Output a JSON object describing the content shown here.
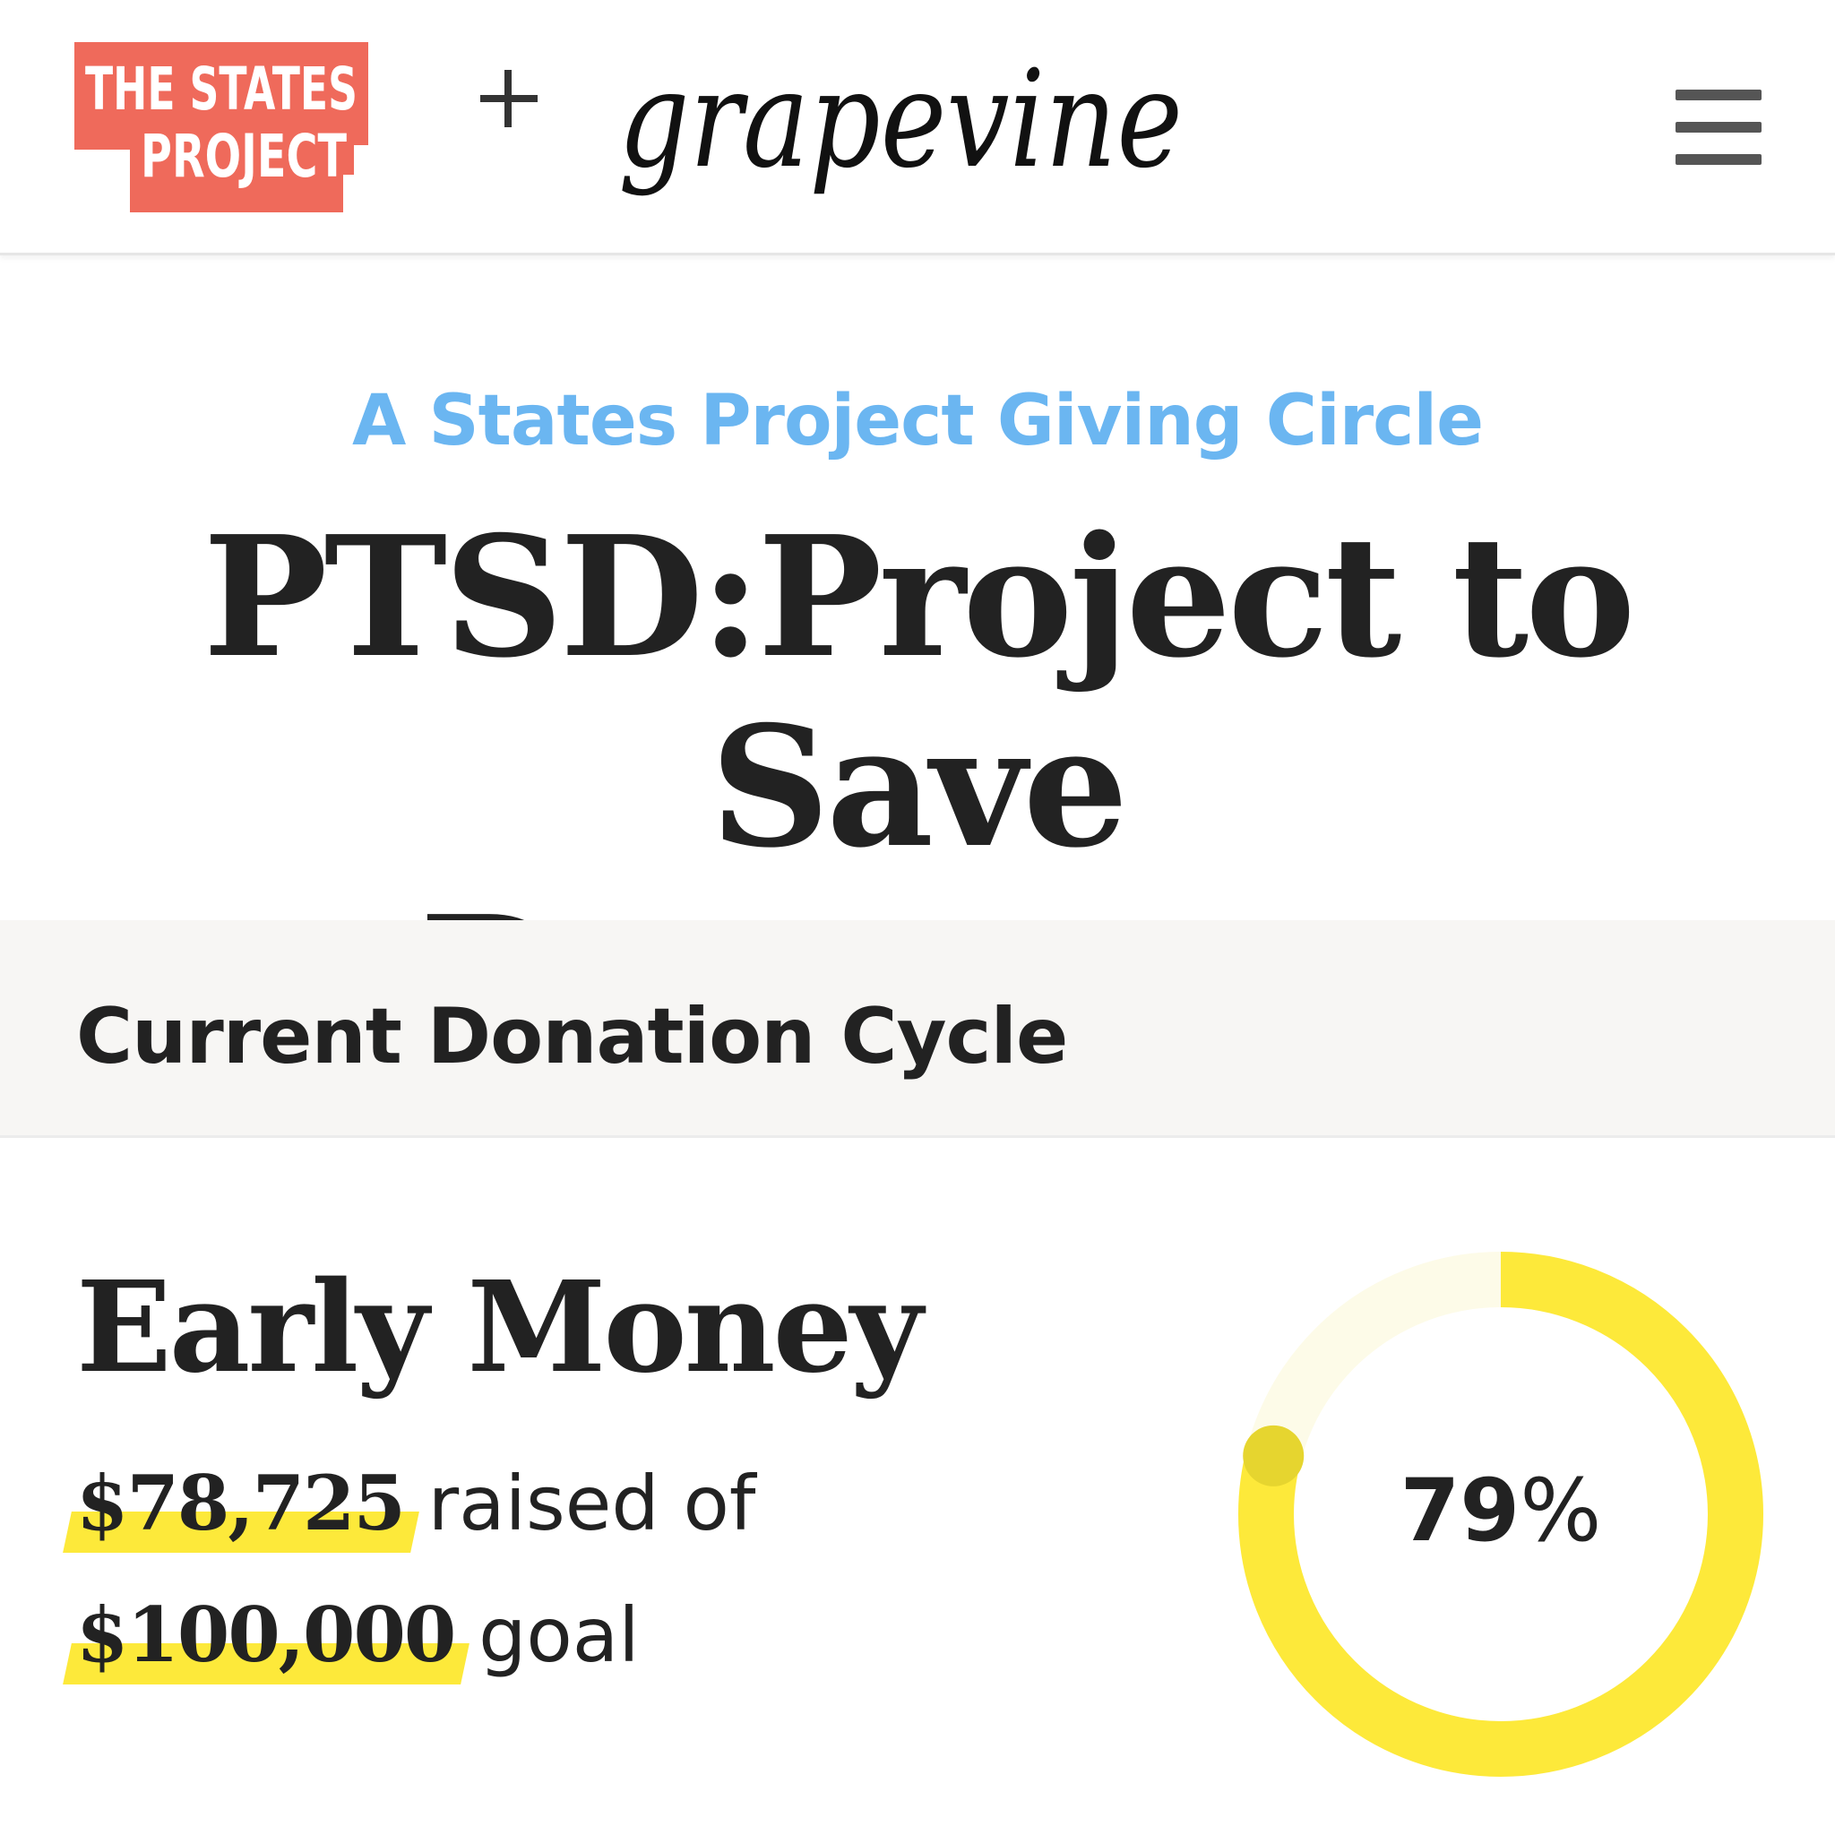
{
  "header": {
    "logo_line1": "THE STATES",
    "logo_line2": "PROJECT",
    "plus": "+",
    "partner_logo": "grapevine",
    "menu_icon": "hamburger-menu-icon"
  },
  "eyebrow": "A States Project Giving Circle",
  "title_line1": "PTSD:Project to Save",
  "title_line2": "Democracy",
  "section": {
    "title": "Current Donation Cycle"
  },
  "campaign": {
    "name": "Early Money",
    "raised": "$78,725",
    "raised_suffix": "raised of",
    "goal": "$100,000",
    "goal_suffix": "goal",
    "progress_number": "79",
    "progress_sign": "%",
    "progress_fraction": 0.79
  },
  "colors": {
    "logo_red": "#ef6a5b",
    "eyebrow_blue": "#6bb6f1",
    "progress_yellow": "#fde93a",
    "progress_track": "#fdfbe8",
    "progress_knob": "#e6d52f"
  }
}
